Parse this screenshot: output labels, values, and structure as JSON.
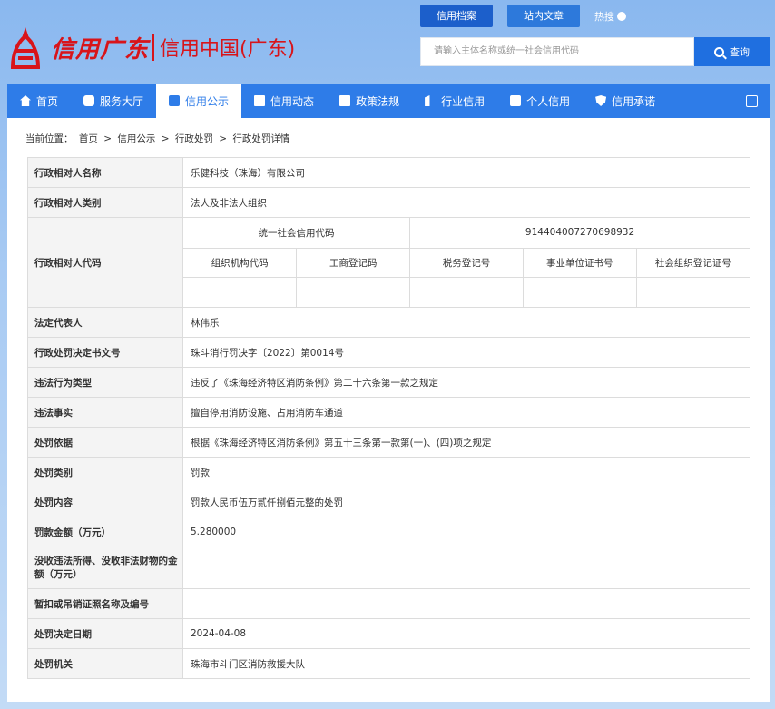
{
  "header": {
    "logo_script": "信用广东",
    "logo_text": "信用中国(广东)",
    "top_tabs": [
      "信用档案",
      "站内文章"
    ],
    "hot_label": "热搜",
    "search_placeholder": "请输入主体名称或统一社会信用代码",
    "search_button": "查询"
  },
  "nav": {
    "items": [
      {
        "label": "首页",
        "icon": "home-icon"
      },
      {
        "label": "服务大厅",
        "icon": "grid-icon"
      },
      {
        "label": "信用公示",
        "icon": "briefcase-icon",
        "active": true
      },
      {
        "label": "信用动态",
        "icon": "document-icon"
      },
      {
        "label": "政策法规",
        "icon": "book-icon"
      },
      {
        "label": "行业信用",
        "icon": "building-icon"
      },
      {
        "label": "个人信用",
        "icon": "user-card-icon"
      },
      {
        "label": "信用承诺",
        "icon": "shield-icon"
      }
    ]
  },
  "breadcrumb": {
    "prefix": "当前位置：",
    "items": [
      "首页",
      "信用公示",
      "行政处罚",
      "行政处罚详情"
    ],
    "separator": ">"
  },
  "detail": {
    "rows": [
      {
        "label": "行政相对人名称",
        "value": "乐健科技（珠海）有限公司"
      },
      {
        "label": "行政相对人类别",
        "value": "法人及非法人组织"
      }
    ],
    "code_section": {
      "label": "行政相对人代码",
      "uscc_label": "统一社会信用代码",
      "uscc_value": "914404007270698932",
      "sub_headers": [
        "组织机构代码",
        "工商登记码",
        "税务登记号",
        "事业单位证书号",
        "社会组织登记证号"
      ],
      "sub_values": [
        "",
        "",
        "",
        "",
        ""
      ]
    },
    "rows2": [
      {
        "label": "法定代表人",
        "value": "林伟乐"
      },
      {
        "label": "行政处罚决定书文号",
        "value": "珠斗消行罚决字〔2022〕第0014号"
      },
      {
        "label": "违法行为类型",
        "value": "违反了《珠海经济特区消防条例》第二十六条第一款之规定"
      },
      {
        "label": "违法事实",
        "value": "擅自停用消防设施、占用消防车通道"
      },
      {
        "label": "处罚依据",
        "value": "根据《珠海经济特区消防条例》第五十三条第一款第(一)、(四)项之规定"
      },
      {
        "label": "处罚类别",
        "value": "罚款"
      },
      {
        "label": "处罚内容",
        "value": "罚款人民币伍万贰仟捌佰元整的处罚"
      },
      {
        "label": "罚款金额（万元）",
        "value": "5.280000"
      },
      {
        "label": "没收违法所得、没收非法财物的金额（万元）",
        "value": ""
      },
      {
        "label": "暂扣或吊销证照名称及编号",
        "value": ""
      },
      {
        "label": "处罚决定日期",
        "value": "2024-04-08"
      },
      {
        "label": "处罚机关",
        "value": "珠海市斗门区消防救援大队"
      }
    ]
  },
  "colors": {
    "brand_red": "#d8141a",
    "nav_blue": "#2e7ce8",
    "button_blue": "#1f6fe0"
  }
}
